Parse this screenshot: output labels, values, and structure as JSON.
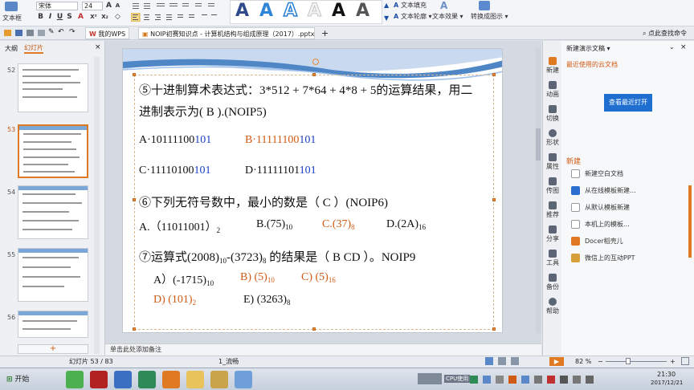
{
  "ribbon": {
    "textbox_label": "文本框",
    "font_name": "宋体",
    "font_size": "24",
    "text_fill_label": "文本填充",
    "text_outline_label": "文本轮廓",
    "text_effect_label": "文本效果",
    "convert_label": "转换成图示"
  },
  "tabs": {
    "wps_tab": "我的WPS",
    "doc_tab": "NOIP初赛知识点 - 计算机结构与组成原理（2017）.pptx *",
    "add_tab": "+",
    "search_placeholder": "点此查找命令"
  },
  "left_panel": {
    "tab_outline": "大纲",
    "tab_slides": "幻灯片",
    "slide_numbers": [
      "52",
      "53",
      "54",
      "55",
      "56"
    ],
    "add_button": "+"
  },
  "slide": {
    "q5_line1_a": "⑤十进制算术表达式：",
    "q5_line1_b": "3*512 + 7*64 + 4*8 + 5的运算结果，用二",
    "q5_line2": "进制表示为(   B     ).(NOIP5)",
    "q5_a_prefix": "A·10111100",
    "q5_a_suffix": "101",
    "q5_b_prefix": "B·11111100",
    "q5_b_suffix": "101",
    "q5_c_prefix": "C·11110100",
    "q5_c_suffix": "101",
    "q5_d_prefix": "D·11111101",
    "q5_d_suffix": "101",
    "q6_line": "⑥下列无符号数中，最小的数是（   C   ）(NOIP6)",
    "q6_a": "A.（11011001）",
    "q6_a_sub": "2",
    "q6_b": "B.(75)",
    "q6_b_sub": "10",
    "q6_c": "C.(37)",
    "q6_c_sub": "8",
    "q6_d": "D.(2A)",
    "q6_d_sub": "16",
    "q7_p1": "⑦运算式(2008)",
    "q7_sub1": "10",
    "q7_p2": "-(3723)",
    "q7_sub2": "8",
    "q7_p3": " 的结果是（ B CD ）。NOIP9",
    "q7_a": "A）(-1715)",
    "q7_a_sub": "10",
    "q7_b": "B) (5)",
    "q7_b_sub": "10",
    "q7_c": "C) (5)",
    "q7_c_sub": "16",
    "q7_d": "D)  (101)",
    "q7_d_sub": "2",
    "q7_e": "E) (3263)",
    "q7_e_sub": "8"
  },
  "right_bar": {
    "items": [
      "新建",
      "动画",
      "切换",
      "形状",
      "属性",
      "传图",
      "推荐",
      "分享",
      "工具",
      "备份",
      "帮助"
    ]
  },
  "right_panel": {
    "title": "新建演示文稿",
    "recent_cloud": "最近使用的云文档",
    "open_recent_button": "查看最近打开",
    "new_section": "新建",
    "items": [
      "新建空白文档",
      "从在线模板新建...",
      "从默认模板新建",
      "本机上的模板...",
      "Docer稻壳儿",
      "微信上的互动PPT"
    ]
  },
  "notes_placeholder": "单击此处添加备注",
  "status": {
    "slide_counter": "幻灯片 53 / 83",
    "theme": "1_流畅",
    "zoom": "82 %"
  },
  "taskbar": {
    "start_label": "开始",
    "cpu_label": "CPU使用",
    "time": "21:30",
    "date": "2017/12/21"
  },
  "colors": {
    "accent_blue": "#1a3fc4",
    "accent_orange": "#d05a14",
    "wps_blue_button": "#1f6fd1"
  }
}
